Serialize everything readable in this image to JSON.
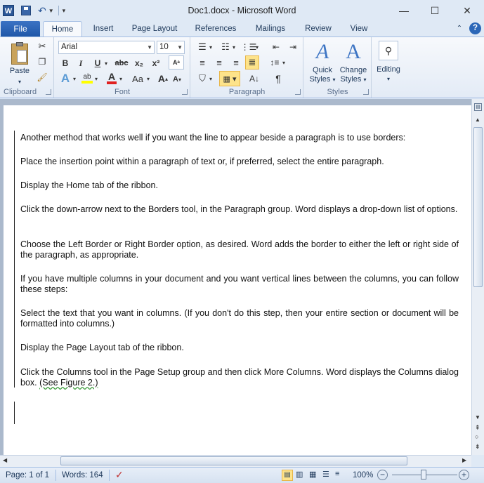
{
  "window": {
    "title": "Doc1.docx - Microsoft Word",
    "app_icon": "W"
  },
  "tabs": {
    "file": "File",
    "items": [
      "Home",
      "Insert",
      "Page Layout",
      "References",
      "Mailings",
      "Review",
      "View"
    ],
    "active": "Home"
  },
  "ribbon": {
    "clipboard": {
      "label": "Clipboard",
      "paste": "Paste"
    },
    "font": {
      "label": "Font",
      "family": "Arial",
      "size": "10",
      "bold": "B",
      "italic": "I",
      "underline": "U",
      "strike": "abc",
      "sub": "x₂",
      "sup": "x²",
      "grow": "A",
      "shrink": "A",
      "case": "Aa",
      "color_a": "A",
      "text_effects": "A"
    },
    "paragraph": {
      "label": "Paragraph",
      "pilcrow": "¶"
    },
    "styles": {
      "label": "Styles",
      "quick_styles_1": "Quick",
      "quick_styles_2": "Styles",
      "change_styles_1": "Change",
      "change_styles_2": "Styles"
    },
    "editing": {
      "label": "Editing"
    }
  },
  "document": {
    "paragraphs": [
      "Another method that works well if you want the line to appear beside a paragraph is to use borders:",
      "Place the insertion point within a paragraph of text or, if preferred, select the entire paragraph.",
      "Display the Home tab of the ribbon.",
      "Click the down-arrow next to the Borders tool, in the Paragraph group. Word displays a drop-down list of options.",
      "Choose the Left Border or Right Border option, as desired. Word adds the border to either the left or right side of the paragraph, as appropriate.",
      "If you have multiple columns in your document and you want vertical lines between the columns, you can follow these steps:",
      "Select the text that you want in columns. (If you don't do this step, then your entire section or document will be formatted into columns.)",
      "Display the Page Layout tab of the ribbon.",
      "Click the Columns tool in the Page Setup group and then click More Columns. Word displays the Columns dialog box."
    ],
    "figure_ref": "(See Figure 2.)"
  },
  "status": {
    "page": "Page: 1 of 1",
    "words": "Words: 164",
    "zoom": "100%",
    "zoom_minus": "−",
    "zoom_plus": "+"
  }
}
